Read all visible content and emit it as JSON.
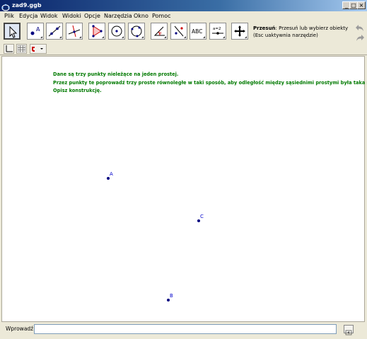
{
  "window": {
    "title": "zad9.ggb",
    "controls": {
      "minimize": "_",
      "maximize": "□",
      "close": "×"
    }
  },
  "menu": [
    "Plik",
    "Edycja",
    "Widok",
    "Widoki",
    "Opcje",
    "Narzędzia",
    "Okno",
    "Pomoc"
  ],
  "toolbar": {
    "tools": [
      "move-tool-icon",
      "point-tool-icon",
      "line-tool-icon",
      "perpendicular-line-tool-icon",
      "polygon-tool-icon",
      "circle-tool-icon",
      "circle-three-points-tool-icon",
      "angle-tool-icon",
      "reflect-tool-icon",
      "text-tool-icon",
      "slider-tool-icon",
      "move-view-tool-icon"
    ],
    "text_tool_label": "ABC",
    "slider_tool_label": "a=2",
    "help_title": "Przesuń",
    "help_text": ": Przesuń lub wybierz obiekty",
    "help_hint": "(Esc uaktywnia narzędzie)"
  },
  "task": {
    "line1": "Dane są trzy punkty nieleżące na jeden prostej.",
    "line2": "Przez punkty te poprowadź trzy proste równoległe w taki sposób, aby odległość między sąsiednimi prostymi była taka sama.",
    "line3": "Opisz konstrukcję."
  },
  "points": [
    {
      "label": "A"
    },
    {
      "label": "C"
    },
    {
      "label": "B"
    }
  ],
  "inputbar": {
    "label": "Wprowadź:",
    "value": ""
  },
  "colors": {
    "task_text": "#007a00",
    "point": "#000080",
    "point_label": "#0000cc"
  }
}
